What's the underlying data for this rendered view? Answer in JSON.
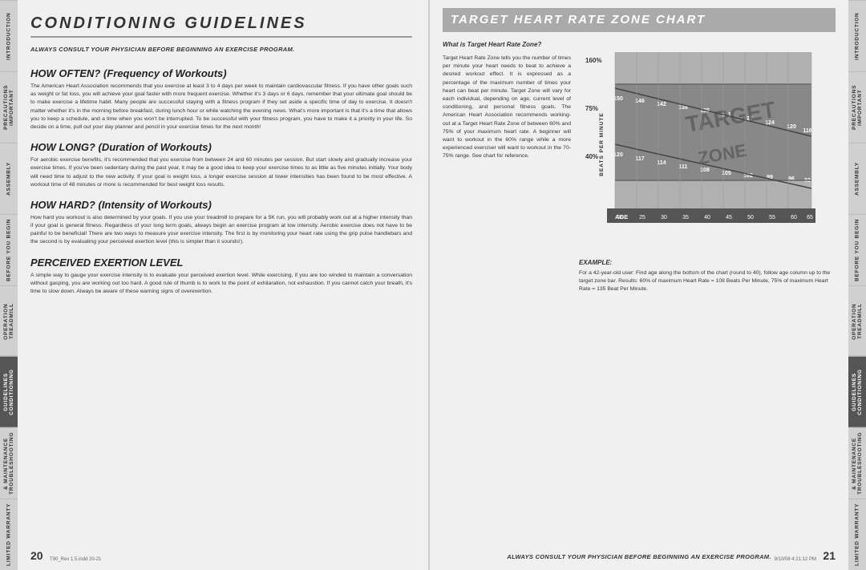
{
  "leftTabs": [
    {
      "label": "INTRODUCTION",
      "active": false
    },
    {
      "label": "IMPORTANT PRECAUTIONS",
      "active": false
    },
    {
      "label": "ASSEMBLY",
      "active": false
    },
    {
      "label": "BEFORE YOU BEGIN",
      "active": false
    },
    {
      "label": "TREADMILL OPERATION",
      "active": false
    },
    {
      "label": "CONDITIONING GUIDELINES",
      "active": true
    },
    {
      "label": "TROUBLESHOOTING & MAINTENANCE",
      "active": false
    },
    {
      "label": "LIMITED WARRANTY",
      "active": false
    }
  ],
  "rightTabs": [
    {
      "label": "INTRODUCTION",
      "active": false
    },
    {
      "label": "IMPORTANT PRECAUTIONS",
      "active": false
    },
    {
      "label": "ASSEMBLY",
      "active": false
    },
    {
      "label": "BEFORE YOU BEGIN",
      "active": false
    },
    {
      "label": "TREADMILL OPERATION",
      "active": false
    },
    {
      "label": "CONDITIONING GUIDELINES",
      "active": true
    },
    {
      "label": "TROUBLESHOOTING & MAINTENANCE",
      "active": false
    },
    {
      "label": "LIMITED WARRANTY",
      "active": false
    }
  ],
  "leftPage": {
    "title": "CONDITIONING GUIDELINES",
    "alwaysConsult": "ALWAYS CONSULT YOUR PHYSICIAN BEFORE BEGINNING AN EXERCISE PROGRAM.",
    "sections": [
      {
        "title": "HOW OFTEN? (Frequency of Workouts)",
        "text": "The American Heart Association recommends that you exercise at least 3 to 4 days per week to maintain cardiovascular fitness. If you have other goals such as weight or fat loss, you will achieve your goal faster with more frequent exercise. Whether it's 3 days or 6 days, remember that your ultimate goal should be to make exercise a lifetime habit. Many people are successful staying with a fitness program if they set aside a specific time of day to exercise. It doesn't matter whether it's in the morning before breakfast, during lunch hour or while watching the evening news. What's more important is that it's a time that allows you to keep a schedule, and a time when you won't be interrupted. To be successful with your fitness program, you have to make it a priority in your life. So decide on a time, pull out your day planner and pencil in your exercise times for the next month!"
      },
      {
        "title": "HOW LONG? (Duration of Workouts)",
        "text": "For aerobic exercise benefits, it's recommended that you exercise from between 24 and 60 minutes per session. But start slowly and gradually increase your exercise times. If you've been sedentary during the past year, it may be a good idea to keep your exercise times to as little as five minutes initially. Your body will need time to adjust to the new activity. If your goal is weight loss, a longer exercise session at lower intensities has been found to be most effective. A workout time of 48 minutes or more is recommended for best weight loss results."
      },
      {
        "title": "HOW HARD? (Intensity of Workouts)",
        "text": "How hard you workout is also determined by your goals. If you use your treadmill to prepare for a 5K run, you will probably work out at a higher intensity than if your goal is general fitness. Regardless of your long term goals, always begin an exercise program at low intensity. Aerobic exercise does not have to be painful to be beneficial! There are two ways to measure your exercise intensity. The first is by monitoring your heart rate using the grip pulse handlebars and the second is by evaluating your perceived exertion level (this is simpler than it sounds!)."
      },
      {
        "title": "PERCEIVED EXERTION LEVEL",
        "text": "A simple way to gauge your exercise intensity is to evaluate your perceived exertion level. While exercising, if you are too winded to maintain a conversation without gasping, you are working out too hard. A good rule of thumb is to work to the point of exhilaration, not exhaustion. If you cannot catch your breath, it's time to slow down. Always be aware of these warning signs of overexertion."
      }
    ],
    "pageNumber": "20",
    "footerText": "T90_Rev 1.5.indd  20-21"
  },
  "rightPage": {
    "title": "TARGET HEART RATE ZONE CHART",
    "whatIsTitle": "What is Target Heart Rate Zone?",
    "description": "Target Heart Rate Zone tells you the number of times per minute your heart needs to beat to achieve a desired workout effect. It is expressed as a percentage of the maximum number of times your heart can beat per minute. Target Zone will vary for each individual, depending on age, current level of conditioning, and personal fitness goals. The American Heart Association recommends working-out at a Target Heart Rate Zone of between 60% and 75% of your maximum heart rate. A beginner will want to workout in the 60% range while a more experienced exerciser will want to workout in the 70-75% range. See chart for reference.",
    "exampleTitle": "EXAMPLE:",
    "exampleText": "For a 42-year-old user: Find age along the bottom of the chart (round to 40), follow age column up to the target zone bar. Results: 60% of maximum Heart Rate = 108 Beats Per Minute, 75% of maximum Heart Rate = 135 Beat Per Minute.",
    "alwaysConsult": "ALWAYS CONSULT YOUR PHYSICIAN BEFORE BEGINNING AN EXERCISE PROGRAM.",
    "pageNumber": "21",
    "footerTextRight": "9/10/08  4:21:12 PM",
    "chart": {
      "percentages": [
        "160%",
        "75%",
        "40%"
      ],
      "ages": [
        "20",
        "25",
        "30",
        "35",
        "40",
        "45",
        "50",
        "55",
        "60",
        "65"
      ],
      "beatsLabel": "BEATS PER MINUTE",
      "ageLabel": "AGE",
      "targetLabel": "TARGET",
      "zoneLabel": "ZONE",
      "values75": [
        150,
        146,
        142,
        138,
        135,
        131,
        127,
        123,
        120,
        116
      ],
      "values60": [
        120,
        117,
        114,
        111,
        108,
        105,
        102,
        99,
        96,
        93
      ]
    }
  }
}
